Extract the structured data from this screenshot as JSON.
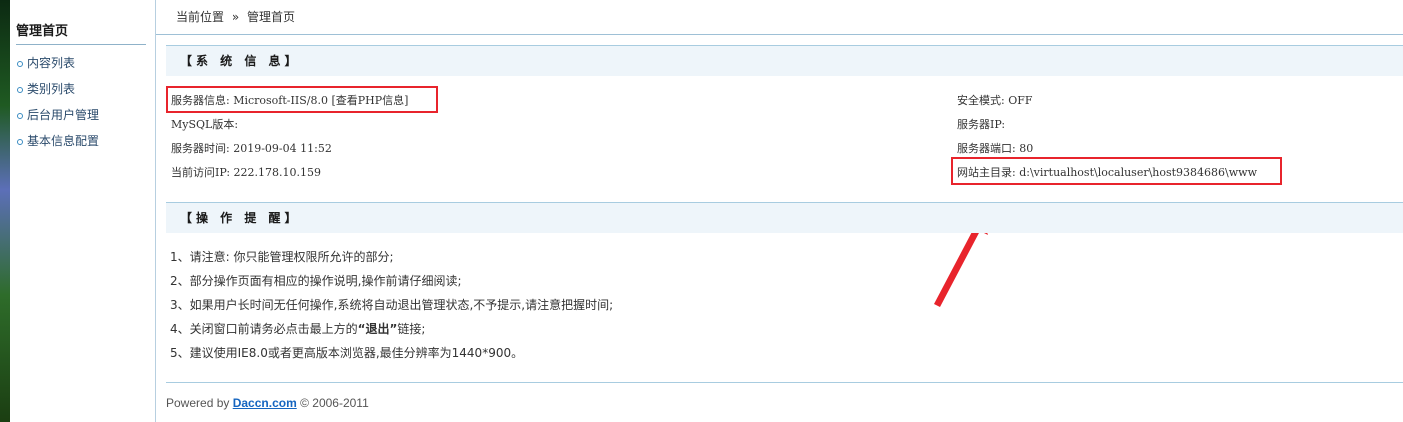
{
  "sidebar": {
    "title": "管理首页",
    "items": [
      {
        "label": "内容列表"
      },
      {
        "label": "类别列表"
      },
      {
        "label": "后台用户管理"
      },
      {
        "label": "基本信息配置"
      }
    ]
  },
  "breadcrumb": {
    "prefix": "当前位置",
    "separator": "»",
    "current": "管理首页"
  },
  "system_info": {
    "heading": "【系 统 信 息】",
    "server_info_label": "服务器信息:",
    "server_info_value": "Microsoft-IIS/8.0",
    "php_info_link": "[查看PHP信息]",
    "mysql_version": "MySQL版本:",
    "server_time": "服务器时间: 2019-09-04 11:52",
    "visitor_ip": "当前访问IP: 222.178.10.159",
    "safe_mode": "安全模式: OFF",
    "server_ip": "服务器IP:",
    "server_port": "服务器端口: 80",
    "web_root": "网站主目录: d:\\virtualhost\\localuser\\host9384686\\www"
  },
  "tips": {
    "heading": "【操 作 提 醒】",
    "items": [
      "1、请注意: 你只能管理权限所允许的部分;",
      "2、部分操作页面有相应的操作说明,操作前请仔细阅读;",
      "3、如果用户长时间无任何操作,系统将自动退出管理状态,不予提示,请注意把握时间;"
    ],
    "item4_prefix": "4、关闭窗口前请务必点击最上方的",
    "item4_bold": "“退出”",
    "item4_suffix": "链接;",
    "item5": "5、建议使用IE8.0或者更高版本浏览器,最佳分辨率为1440*900。"
  },
  "footer": {
    "prefix": "Powered by",
    "link": "Daccn.com",
    "suffix": "© 2006-2011"
  },
  "colors": {
    "highlight_box": "#e8242c",
    "section_bg": "#eef5fa",
    "link_blue": "#1565c0"
  }
}
